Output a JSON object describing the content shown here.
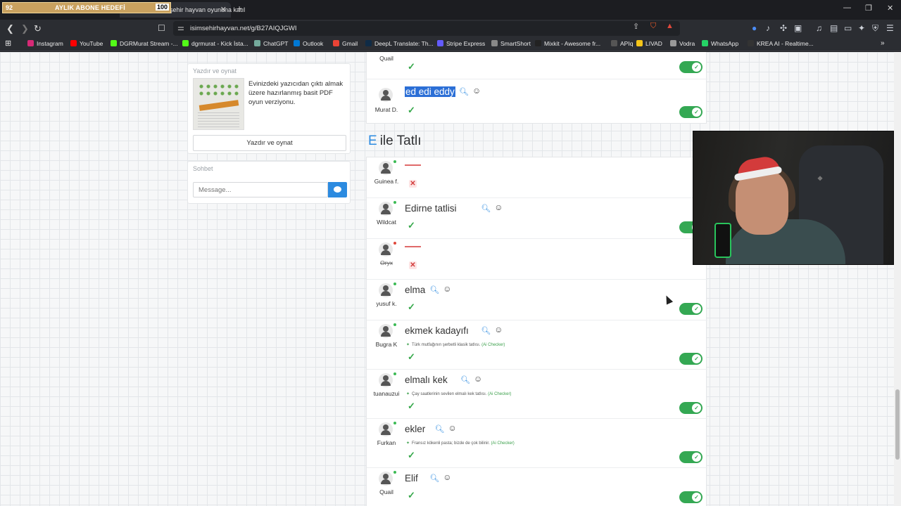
{
  "overlay": {
    "goal_left": "92",
    "goal_title": "AYLIK ABONE HEDEFİ",
    "goal_right": "100"
  },
  "browser": {
    "tab_title": "Isim şehir hayvan oyununa katıl",
    "url": "isimsehirhayvan.net/g/B27AIQJGWI",
    "bookmarks": [
      "Instagram",
      "YouTube",
      "DGRMurat Stream -...",
      "dgrmurat - Kick İsta...",
      "ChatGPT",
      "Outlook",
      "Gmail",
      "DeepL Translate: Th...",
      "Stripe Express",
      "SmartShort",
      "Mixkit - Awesome fr...",
      "APIq",
      "LIVAD",
      "Vodra",
      "WhatsApp",
      "KREA AI - Realtime..."
    ],
    "bookmark_colors": [
      "#d62976",
      "#ff0000",
      "#53fc18",
      "#53fc18",
      "#74aa9c",
      "#0078d4",
      "#ea4335",
      "#0f2b46",
      "#635bff",
      "#888888",
      "#222222",
      "#555555",
      "#f5c518",
      "#999999",
      "#25d366",
      "#333333"
    ]
  },
  "sidebar": {
    "print_card": {
      "header": "Yazdır ve oynat",
      "description": "Evinizdeki yazıcıdan çıktı almak üzere hazırlanmış basit PDF oyun verziyonu.",
      "button": "Yazdır ve oynat"
    },
    "chat": {
      "header": "Sohbet",
      "placeholder": "Message..."
    }
  },
  "top_rows": [
    {
      "user": "Quail",
      "answer": "",
      "valid": true,
      "approved": true
    },
    {
      "user": "Murat D.",
      "answer": "ed edi eddy",
      "valid": true,
      "approved": true,
      "selected": true
    }
  ],
  "section": {
    "letter": "E",
    "title": "ile Tatlı"
  },
  "rows": [
    {
      "user": "Guinea f.",
      "answer": "",
      "valid": false,
      "approved": null,
      "online": true,
      "strike": false
    },
    {
      "user": "Wildcat",
      "answer": "Edirne tatlisi",
      "valid": true,
      "approved": true,
      "online": true,
      "strike": false
    },
    {
      "user": "Oryx",
      "answer": "",
      "valid": false,
      "approved": null,
      "online": false,
      "strike": true
    },
    {
      "user": "yusuf k.",
      "answer": "elma",
      "valid": true,
      "approved": true,
      "online": true,
      "strike": false
    },
    {
      "user": "Bugra K",
      "answer": "ekmek kadayıfı",
      "ai_note": "Türk mutfağının şerbetli klasik tatlısı.",
      "ai_label": "(Ai Checker)",
      "valid": true,
      "approved": true,
      "online": true,
      "strike": false
    },
    {
      "user": "tuanauzui",
      "answer": "elmalı kek",
      "ai_note": "Çay saatlerinin sevilen elmalı kek tatlısı.",
      "ai_label": "(Ai Checker)",
      "valid": true,
      "approved": true,
      "online": true,
      "strike": false
    },
    {
      "user": "Furkan",
      "answer": "ekler",
      "ai_note": "Fransız kökenli pasta; bizde de çok bilinir.",
      "ai_label": "(Ai Checker)",
      "valid": true,
      "approved": true,
      "online": true,
      "strike": false
    },
    {
      "user": "Quail",
      "answer": "Elif",
      "valid": true,
      "approved": true,
      "online": true,
      "strike": false
    }
  ],
  "colors": {
    "accent": "#2c8be0",
    "valid": "#35a84a",
    "invalid": "#d23b3b",
    "toggle_on": "#34a853",
    "selection": "#2c6fd6"
  }
}
